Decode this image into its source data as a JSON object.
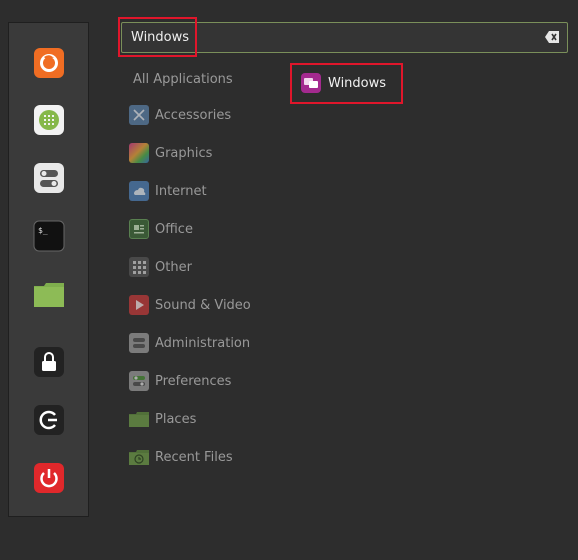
{
  "search": {
    "value": "Windows"
  },
  "sidebar": {
    "all_applications": "All Applications",
    "categories": [
      {
        "label": "Accessories",
        "icon": "accessories-icon"
      },
      {
        "label": "Graphics",
        "icon": "graphics-icon"
      },
      {
        "label": "Internet",
        "icon": "internet-icon"
      },
      {
        "label": "Office",
        "icon": "office-icon"
      },
      {
        "label": "Other",
        "icon": "other-icon"
      },
      {
        "label": "Sound & Video",
        "icon": "sound-video-icon"
      },
      {
        "label": "Administration",
        "icon": "administration-icon"
      },
      {
        "label": "Preferences",
        "icon": "preferences-icon"
      },
      {
        "label": "Places",
        "icon": "places-folder-icon"
      },
      {
        "label": "Recent Files",
        "icon": "recent-files-icon"
      }
    ]
  },
  "favorites": [
    {
      "icon": "firefox-icon"
    },
    {
      "icon": "software-manager-icon"
    },
    {
      "icon": "system-settings-icon"
    },
    {
      "icon": "terminal-icon"
    },
    {
      "icon": "files-folder-icon"
    },
    {
      "icon": "lock-screen-icon"
    },
    {
      "icon": "logout-icon"
    },
    {
      "icon": "shutdown-icon"
    }
  ],
  "results": [
    {
      "label": "Windows",
      "icon": "windows-app-icon"
    }
  ],
  "colors": {
    "accent": "#7a8f5a",
    "highlight": "#e0162b",
    "result_icon": "#a42a8f"
  }
}
